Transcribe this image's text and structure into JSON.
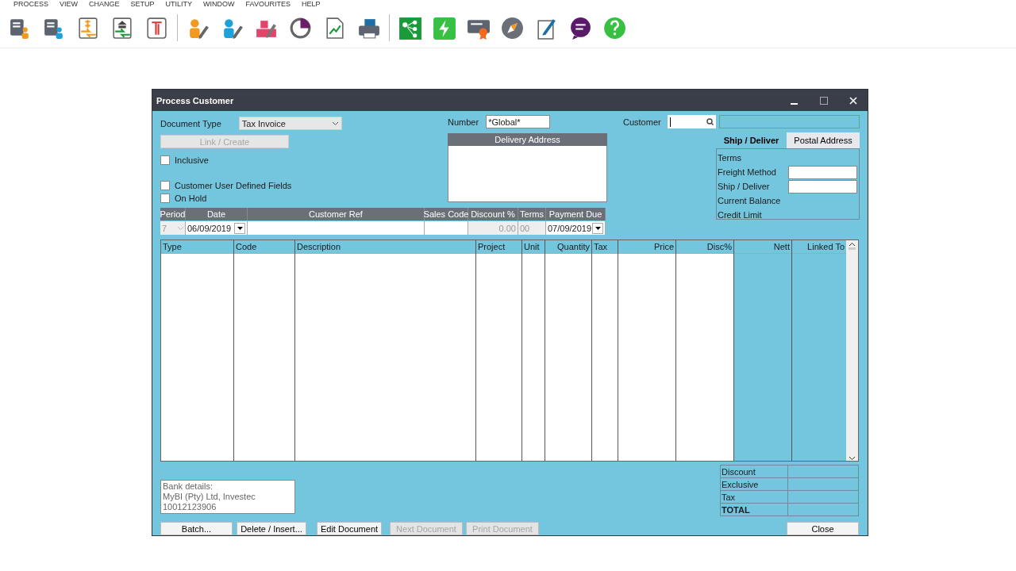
{
  "menu": [
    "PROCESS",
    "VIEW",
    "CHANGE",
    "SETUP",
    "UTILITY",
    "WINDOW",
    "FAVOURITES",
    "HELP"
  ],
  "window": {
    "title": "Process Customer"
  },
  "document_type": {
    "label": "Document Type",
    "value": "Tax Invoice"
  },
  "link_button": {
    "label": "Link / Create",
    "disabled": true
  },
  "checkboxes": [
    {
      "label": "Inclusive",
      "checked": false
    },
    {
      "label": "Customer User Defined Fields",
      "checked": false
    },
    {
      "label": "On Hold",
      "checked": false
    }
  ],
  "number": {
    "label": "Number",
    "value": "*Global*"
  },
  "delivery_address": {
    "title": "Delivery Address"
  },
  "customer": {
    "label": "Customer"
  },
  "address_tabs": [
    {
      "label": "Ship / Deliver",
      "selected": true
    },
    {
      "label": "Postal Address",
      "selected": false
    }
  ],
  "address_fields": [
    {
      "label": "Terms",
      "kind": "text"
    },
    {
      "label": "Freight Method",
      "kind": "input"
    },
    {
      "label": "Ship / Deliver",
      "kind": "input"
    },
    {
      "label": "Current Balance",
      "kind": "text"
    },
    {
      "label": "Credit Limit",
      "kind": "text"
    }
  ],
  "doc_fields": [
    {
      "label": "Period",
      "value": "7",
      "kind": "combo",
      "disabled": true
    },
    {
      "label": "Date",
      "value": "06/09/2019",
      "kind": "date",
      "disabled": false
    },
    {
      "label": "Customer Ref",
      "kind": "input",
      "disabled": false
    },
    {
      "label": "Sales Code",
      "kind": "input",
      "disabled": false
    },
    {
      "label": "Discount %",
      "value": "0.00",
      "kind": "number",
      "disabled": true
    },
    {
      "label": "Terms",
      "value": "00",
      "kind": "text",
      "disabled": true
    },
    {
      "label": "Payment Due",
      "value": "07/09/2019",
      "kind": "date",
      "disabled": false
    }
  ],
  "grid_columns": [
    {
      "label": "Type",
      "kind": "entry"
    },
    {
      "label": "Code",
      "kind": "entry"
    },
    {
      "label": "Description",
      "kind": "entry"
    },
    {
      "label": "Project",
      "kind": "entry"
    },
    {
      "label": "Unit",
      "kind": "entry"
    },
    {
      "label": "Quantity",
      "kind": "entry"
    },
    {
      "label": "Tax",
      "kind": "entry"
    },
    {
      "label": "Price",
      "kind": "entry"
    },
    {
      "label": "Disc%",
      "kind": "entry"
    },
    {
      "label": "Nett",
      "kind": "computed"
    },
    {
      "label": "Linked To",
      "kind": "computed"
    }
  ],
  "bank_details": [
    "Bank details:",
    "MyBI (Pty) Ltd, Investec",
    "10012123906"
  ],
  "totals": [
    {
      "label": "Discount",
      "kind": "line"
    },
    {
      "label": "Exclusive",
      "kind": "line"
    },
    {
      "label": "Tax",
      "kind": "line"
    },
    {
      "label": "TOTAL",
      "kind": "total"
    }
  ],
  "buttons": [
    {
      "label": "Batch...",
      "disabled": false
    },
    {
      "label": "Delete / Insert...",
      "disabled": false
    },
    {
      "label": "Edit Document",
      "disabled": false
    },
    {
      "label": "Next Document",
      "disabled": true
    },
    {
      "label": "Print Document",
      "disabled": true
    }
  ],
  "close_button": {
    "label": "Close"
  }
}
